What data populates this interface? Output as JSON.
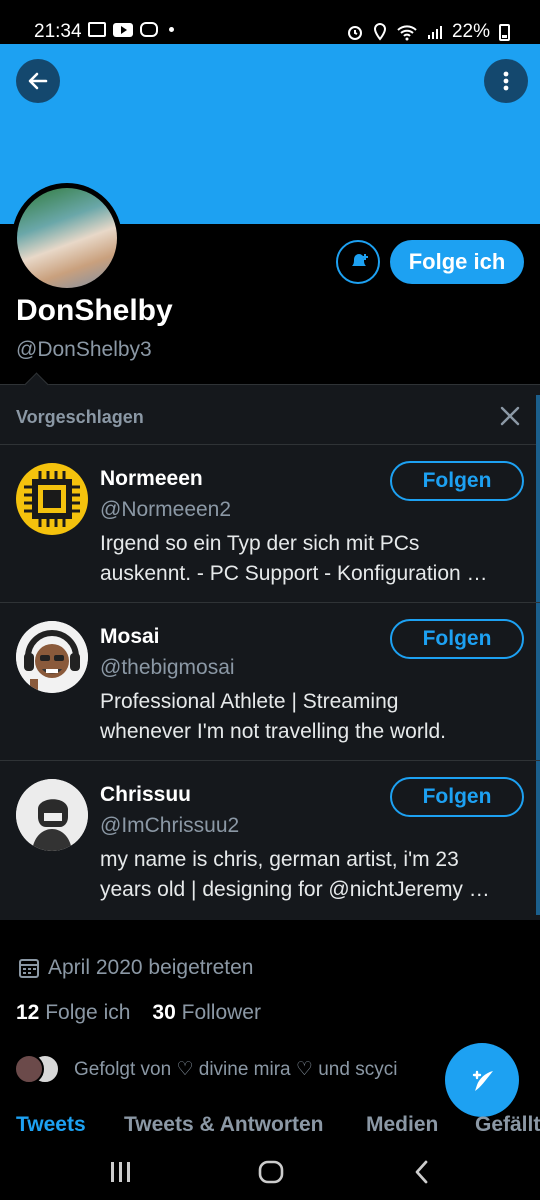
{
  "status_bar": {
    "time": "21:34",
    "battery": "22%"
  },
  "profile": {
    "name": "DonShelby",
    "handle": "@DonShelby3",
    "follow_button": "Folge ich",
    "joined": "April 2020 beigetreten",
    "following_count": "12",
    "following_label": "Folge ich",
    "followers_count": "30",
    "followers_label": "Follower",
    "followed_by": "Gefolgt von ♡ divine mira ♡ und scyci"
  },
  "suggested": {
    "title": "Vorgeschlagen",
    "items": [
      {
        "name": "Normeeen",
        "handle": "@Normeeen2",
        "bio_line1": "Irgend so ein Typ der sich mit PCs",
        "bio_line2": "auskennt.  - PC Support - Konfiguration …",
        "follow": "Folgen"
      },
      {
        "name": "Mosai",
        "handle": "@thebigmosai",
        "bio_line1": "Professional Athlete | Streaming",
        "bio_line2": "whenever I'm not travelling the world.",
        "follow": "Folgen"
      },
      {
        "name": "Chrissuu",
        "handle": "@ImChrissuu2",
        "bio_line1": "my name is chris, german artist, i'm 23",
        "bio_line2": "years old | designing for @nichtJeremy …",
        "follow": "Folgen"
      }
    ]
  },
  "tabs": [
    "Tweets",
    "Tweets & Antworten",
    "Medien",
    "Gefällt"
  ],
  "colors": {
    "accent": "#1da1f2",
    "background": "#000000",
    "panel": "#15181c",
    "muted": "#8b98a5"
  },
  "icons": [
    "back-arrow-icon",
    "more-vertical-icon",
    "bell-plus-icon",
    "close-icon",
    "calendar-icon",
    "compose-tweet-icon",
    "recents-icon",
    "home-icon",
    "nav-back-icon"
  ]
}
